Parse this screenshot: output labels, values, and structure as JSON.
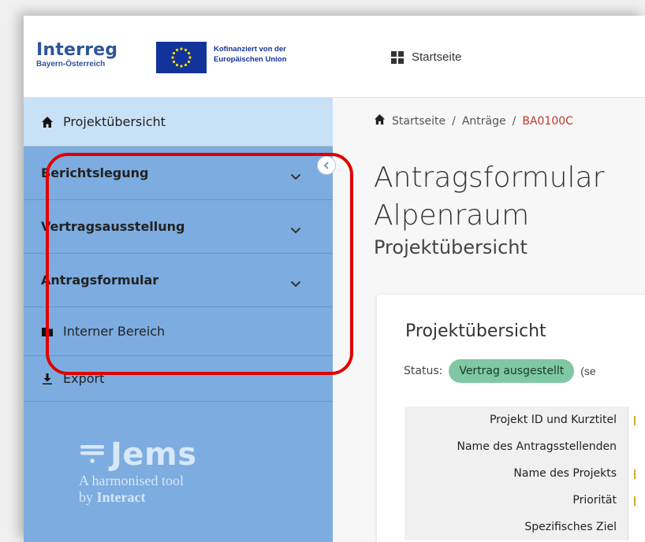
{
  "header": {
    "logo_title": "Interreg",
    "logo_subtitle": "Bayern-Österreich",
    "eu_line1": "Kofinanziert von der",
    "eu_line2": "Europäischen Union",
    "nav_home_label": "Startseite"
  },
  "sidebar": {
    "top_item": "Projektübersicht",
    "items": [
      {
        "label": "Berichtslegung"
      },
      {
        "label": "Vertragsausstellung"
      },
      {
        "label": "Antragsformular"
      }
    ],
    "internal": "Interner Bereich",
    "export": "Export",
    "brand": "Jems",
    "tagline1": "A harmonised tool",
    "tagline2_prefix": "by ",
    "tagline2_bold": "Interact"
  },
  "main": {
    "breadcrumb": [
      "Startseite",
      "Anträge",
      "BA0100C"
    ],
    "breadcrumb_sep": "/",
    "title_line1": "Antragsformular",
    "title_line2": "Alpenraum",
    "subtitle": "Projektübersicht",
    "card": {
      "title": "Projektübersicht",
      "status_label": "Status:",
      "status_value": "Vertrag ausgestellt",
      "status_suffix": "(se",
      "rows": [
        {
          "key": "Projekt ID und Kurztitel"
        },
        {
          "key": "Name des Antragsstellenden"
        },
        {
          "key": "Name des Projekts"
        },
        {
          "key": "Priorität"
        },
        {
          "key": "Spezifisches Ziel"
        }
      ]
    }
  },
  "colors": {
    "sidebar_bg": "#7cace0",
    "sidebar_active_bg": "#c9e1f7",
    "highlight_border": "#e00000",
    "status_badge_bg": "#7fc8a3",
    "brand_blue": "#2f5597"
  }
}
